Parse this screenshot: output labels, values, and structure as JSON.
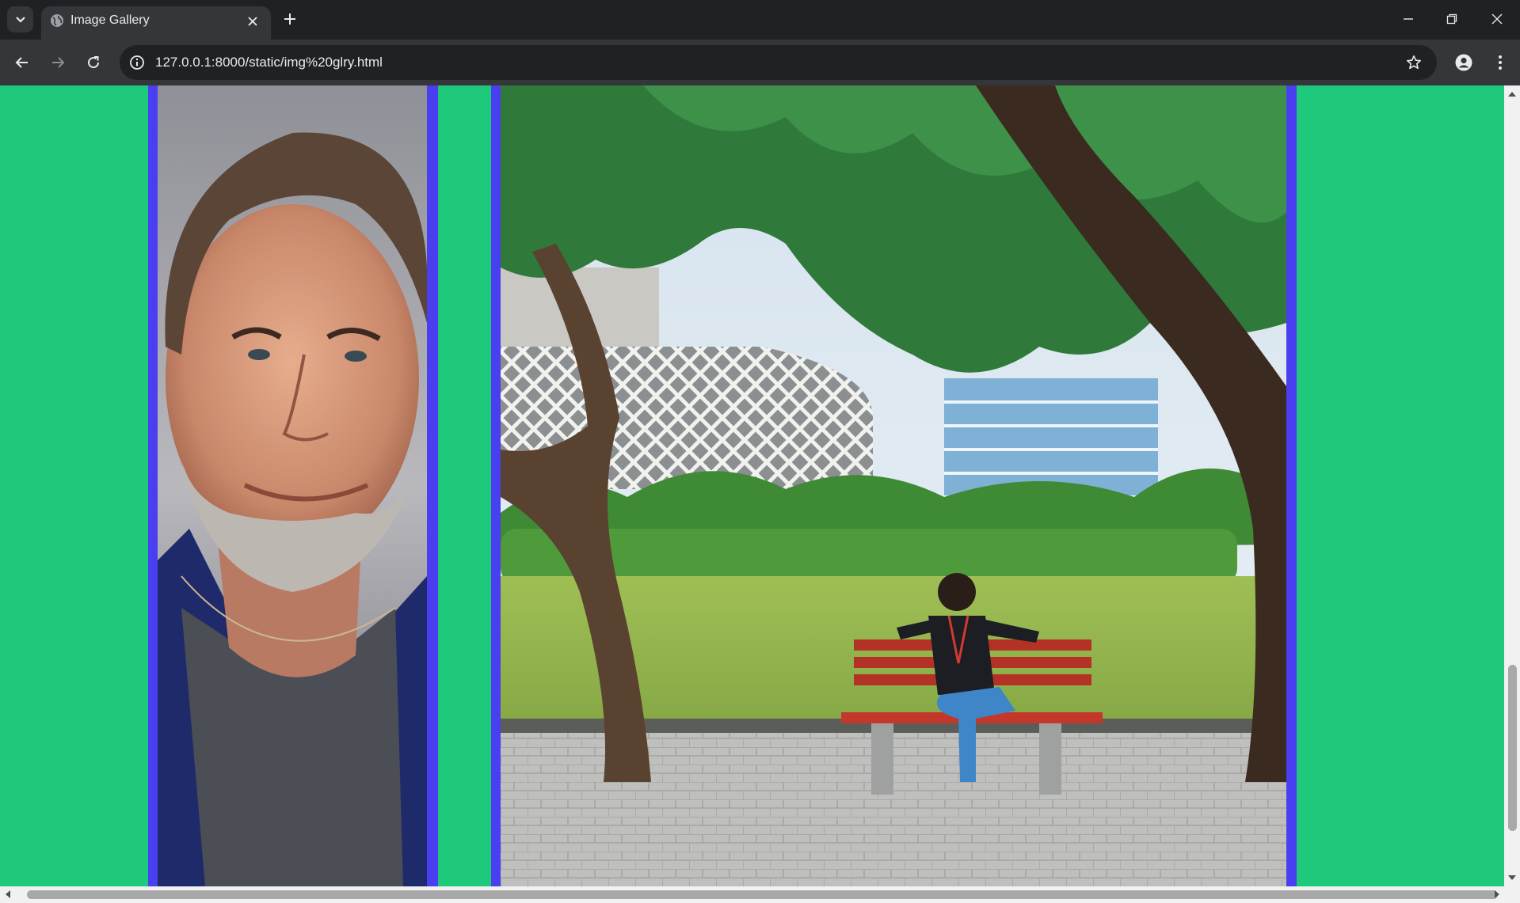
{
  "browser": {
    "tab_title": "Image Gallery",
    "url": "127.0.0.1:8000/static/img%20glry.html",
    "icons": {
      "tab_search": "chevron-down-icon",
      "favicon": "globe-icon",
      "tab_close": "close-icon",
      "new_tab": "plus-icon",
      "minimize": "minimize-icon",
      "restore": "restore-icon",
      "close_window": "close-icon",
      "back": "arrow-left-icon",
      "forward": "arrow-right-icon",
      "reload": "reload-icon",
      "site_info": "info-icon",
      "bookmark": "star-icon",
      "profile": "person-icon",
      "menu": "kebab-menu-icon"
    }
  },
  "page": {
    "background_color": "#1ec97b",
    "frame_color": "#4a3ff0",
    "gallery": [
      {
        "name": "portrait-photo",
        "subject": "portrait"
      },
      {
        "name": "park-bench-photo",
        "subject": "park bench"
      }
    ]
  }
}
